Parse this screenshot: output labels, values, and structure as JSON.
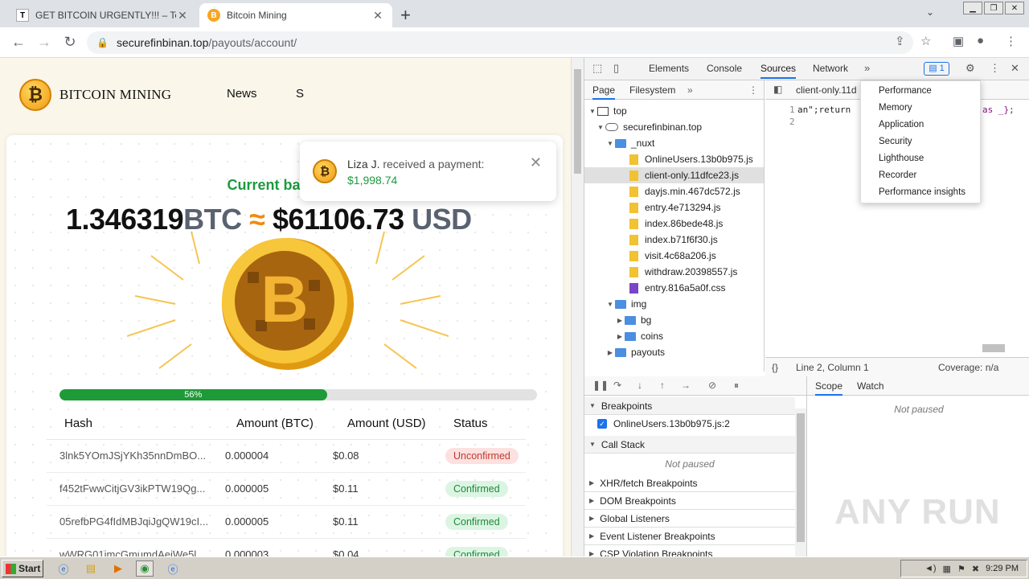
{
  "browser": {
    "tabs": [
      {
        "title": "GET BITCOIN URGENTLY!!! – Telegra",
        "favicon": "T"
      },
      {
        "title": "Bitcoin Mining",
        "favicon": "B"
      }
    ],
    "url_host": "securefinbinan.top",
    "url_path": "/payouts/account/"
  },
  "page": {
    "brand": "BITCOIN MINING",
    "nav": [
      "News",
      "S"
    ],
    "balance_label": "Current balance:",
    "balance_btc": "1.346319",
    "btc_unit": "BTC",
    "approx": "≈",
    "balance_usd": "$61106.73",
    "usd_unit": "USD",
    "progress_percent": 56,
    "progress_label": "56%",
    "table": {
      "headers": [
        "Hash",
        "Amount (BTC)",
        "Amount (USD)",
        "Status"
      ],
      "rows": [
        {
          "hash": "3lnk5YOmJSjYKh35nnDmBO...",
          "btc": "0.000004",
          "usd": "$0.08",
          "status": "Unconfirmed"
        },
        {
          "hash": "f452tFwwCitjGV3ikPTW19Qg...",
          "btc": "0.000005",
          "usd": "$0.11",
          "status": "Confirmed"
        },
        {
          "hash": "05refbPG4fIdMBJqiJgQW19cI...",
          "btc": "0.000005",
          "usd": "$0.11",
          "status": "Confirmed"
        },
        {
          "hash": "wWRG01imcGmumdAeiWe5l...",
          "btc": "0.000003",
          "usd": "$0.04",
          "status": "Confirmed"
        }
      ]
    },
    "toast": {
      "name": "Liza J.",
      "text": " received a payment:",
      "amount": "$1,998.74"
    }
  },
  "devtools": {
    "tabs": [
      "Elements",
      "Console",
      "Sources",
      "Network"
    ],
    "active_tab": "Sources",
    "issues_count": "1",
    "nav_tabs": [
      "Page",
      "Filesystem"
    ],
    "tree": {
      "top": "top",
      "host": "securefinbinan.top",
      "nuxt": "_nuxt",
      "files": [
        "OnlineUsers.13b0b975.js",
        "client-only.11dfce23.js",
        "dayjs.min.467dc572.js",
        "entry.4e713294.js",
        "index.86bede48.js",
        "index.b71f6f30.js",
        "visit.4c68a206.js",
        "withdraw.20398557.js",
        "entry.816a5a0f.css"
      ],
      "img": "img",
      "img_children": [
        "bg",
        "coins"
      ],
      "payouts": "payouts"
    },
    "editor_file": "client-only.11d",
    "code_line1_a": "an\";return ",
    "code_line1_b": "as _};",
    "line_numbers": [
      "1",
      "2"
    ],
    "status_position": "Line 2, Column 1",
    "coverage": "Coverage: n/a",
    "more_menu": [
      "Performance",
      "Memory",
      "Application",
      "Security",
      "Lighthouse",
      "Recorder",
      "Performance insights"
    ],
    "debugger": {
      "breakpoints_label": "Breakpoints",
      "breakpoint_item": "OnlineUsers.13b0b975.js:2",
      "call_stack_label": "Call Stack",
      "not_paused": "Not paused",
      "sections": [
        "XHR/fetch Breakpoints",
        "DOM Breakpoints",
        "Global Listeners",
        "Event Listener Breakpoints",
        "CSP Violation Breakpoints"
      ],
      "scope_tabs": [
        "Scope",
        "Watch"
      ]
    }
  },
  "watermark": "ANY RUN",
  "taskbar": {
    "start": "Start",
    "clock": "9:29 PM"
  }
}
